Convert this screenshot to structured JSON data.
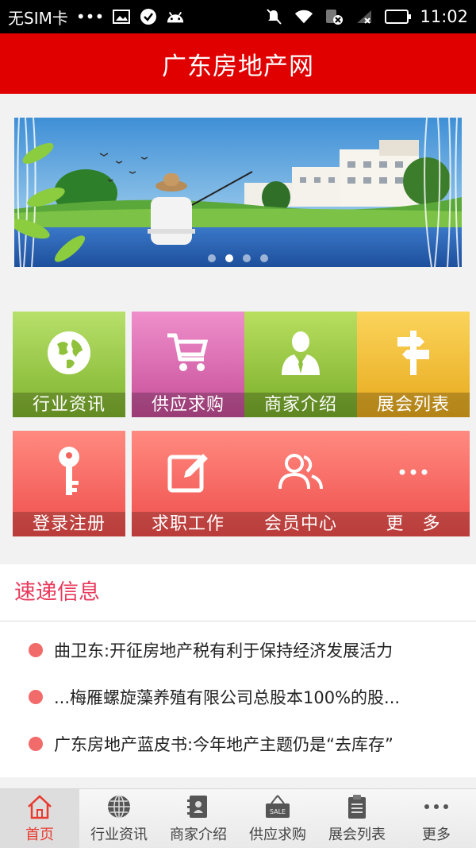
{
  "status_bar": {
    "carrier": "无SIM卡",
    "dots": "•••",
    "time": "11:02",
    "battery_level": 1.0
  },
  "header": {
    "title": "广东房地产网"
  },
  "banner": {
    "slide_count": 4,
    "active_slide": 2
  },
  "tiles": [
    {
      "label": "行业资讯",
      "icon": "globe-icon",
      "color": "#8fc23a"
    },
    {
      "label": "供应求购",
      "icon": "cart-icon",
      "color": "#d65aa8"
    },
    {
      "label": "商家介绍",
      "icon": "person-icon",
      "color": "#8fc23a"
    },
    {
      "label": "展会列表",
      "icon": "signpost-icon",
      "color": "#f0b52a"
    },
    {
      "label": "登录注册",
      "icon": "key-icon",
      "color": "#f4645f"
    },
    {
      "label": "求职工作",
      "icon": "edit-icon",
      "color": "#f4645f"
    },
    {
      "label": "会员中心",
      "icon": "members-icon",
      "color": "#f4645f"
    },
    {
      "label": "更　多",
      "icon": "more-icon",
      "color": "#f4645f"
    }
  ],
  "news": {
    "title": "速递信息",
    "items": [
      "曲卫东:开征房地产税有利于保持经济发展活力",
      "...梅雁螺旋藻养殖有限公司总股本100%的股...",
      "广东房地产蓝皮书:今年地产主题仍是“去库存”"
    ]
  },
  "bottom_nav": {
    "items": [
      {
        "label": "首页",
        "icon": "home-icon",
        "active": true
      },
      {
        "label": "行业资讯",
        "icon": "globe-icon",
        "active": false
      },
      {
        "label": "商家介绍",
        "icon": "contacts-icon",
        "active": false
      },
      {
        "label": "供应求购",
        "icon": "sale-sign-icon",
        "active": false
      },
      {
        "label": "展会列表",
        "icon": "clipboard-icon",
        "active": false
      },
      {
        "label": "更多",
        "icon": "more-icon",
        "active": false
      }
    ]
  },
  "colors": {
    "header": "#e10000",
    "accent": "#e83a5c",
    "active_nav": "#e83a2f"
  }
}
